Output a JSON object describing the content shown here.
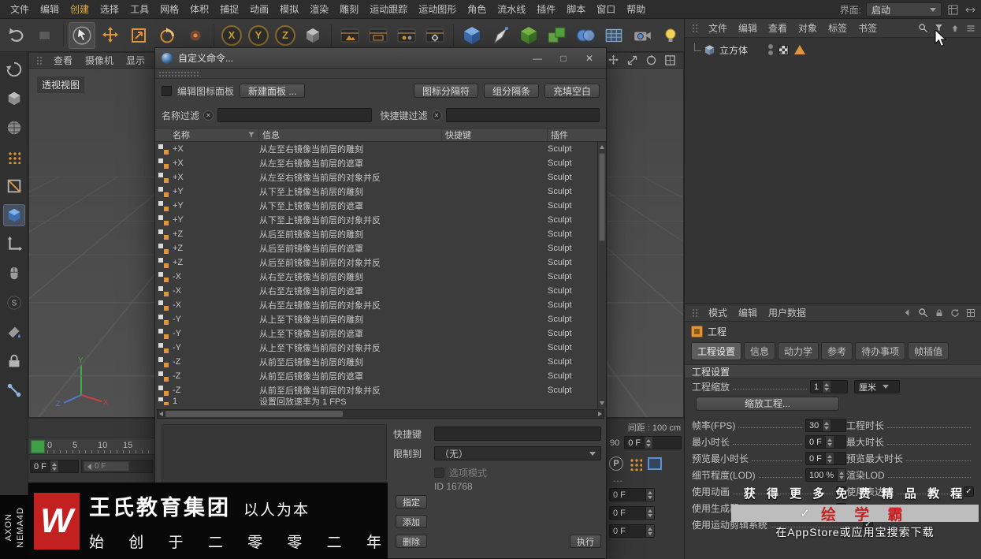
{
  "menubar": {
    "items": [
      "文件",
      "编辑",
      "创建",
      "选择",
      "工具",
      "网格",
      "体积",
      "捕捉",
      "动画",
      "模拟",
      "渲染",
      "雕刻",
      "运动跟踪",
      "运动图形",
      "角色",
      "流水线",
      "插件",
      "脚本",
      "窗口",
      "帮助"
    ],
    "highlight": "创建",
    "interface_label": "界面:",
    "interface_value": "启动"
  },
  "toolbar": {
    "axis_x": "X",
    "axis_y": "Y",
    "axis_z": "Z"
  },
  "viewport": {
    "menu": [
      "查看",
      "摄像机",
      "显示"
    ],
    "label": "透视视图",
    "axis_y": "Y",
    "axis_x": "X",
    "axis_z": "Z"
  },
  "timeline": {
    "ticks": [
      "0",
      "5",
      "10",
      "15"
    ],
    "frame_value": "0 F",
    "slider_value": "0 F",
    "range_end": "90",
    "range_value": "0 F",
    "spacing_text": "间距 : 100 cm",
    "record_letter": "P",
    "ellipsis": "⋯",
    "side_values": [
      "0 F",
      "0 F",
      "0 F"
    ]
  },
  "dialog": {
    "title": "自定义命令...",
    "minimize": "—",
    "maximize": "□",
    "close": "✕",
    "edit_palette_label": "编辑图标面板",
    "new_palette_button": "新建面板 ...",
    "icon_separator_button": "图标分隔符",
    "group_separator_button": "组分隔条",
    "fill_blank_button": "充填空白",
    "name_filter_label": "名称过滤",
    "shortcut_filter_label": "快捷键过滤",
    "clear_glyph": "✕",
    "columns": {
      "name": "名称",
      "info": "信息",
      "shortcut": "快捷键",
      "plugin": "插件"
    },
    "rows": [
      {
        "name": "+X",
        "info": "从左至右镜像当前层的雕刻",
        "shortcut": "",
        "plugin": "Sculpt"
      },
      {
        "name": "+X",
        "info": "从左至右镜像当前层的遮罩",
        "shortcut": "",
        "plugin": "Sculpt"
      },
      {
        "name": "+X",
        "info": "从左至右镜像当前层的对象并反",
        "shortcut": "",
        "plugin": "Sculpt"
      },
      {
        "name": "+Y",
        "info": "从下至上镜像当前层的雕刻",
        "shortcut": "",
        "plugin": "Sculpt"
      },
      {
        "name": "+Y",
        "info": "从下至上镜像当前层的遮罩",
        "shortcut": "",
        "plugin": "Sculpt"
      },
      {
        "name": "+Y",
        "info": "从下至上镜像当前层的对象并反",
        "shortcut": "",
        "plugin": "Sculpt"
      },
      {
        "name": "+Z",
        "info": "从后至前镜像当前层的雕刻",
        "shortcut": "",
        "plugin": "Sculpt"
      },
      {
        "name": "+Z",
        "info": "从后至前镜像当前层的遮罩",
        "shortcut": "",
        "plugin": "Sculpt"
      },
      {
        "name": "+Z",
        "info": "从后至前镜像当前层的对象并反",
        "shortcut": "",
        "plugin": "Sculpt"
      },
      {
        "name": "-X",
        "info": "从右至左镜像当前层的雕刻",
        "shortcut": "",
        "plugin": "Sculpt"
      },
      {
        "name": "-X",
        "info": "从右至左镜像当前层的遮罩",
        "shortcut": "",
        "plugin": "Sculpt"
      },
      {
        "name": "-X",
        "info": "从右至左镜像当前层的对象并反",
        "shortcut": "",
        "plugin": "Sculpt"
      },
      {
        "name": "-Y",
        "info": "从上至下镜像当前层的雕刻",
        "shortcut": "",
        "plugin": "Sculpt"
      },
      {
        "name": "-Y",
        "info": "从上至下镜像当前层的遮罩",
        "shortcut": "",
        "plugin": "Sculpt"
      },
      {
        "name": "-Y",
        "info": "从上至下镜像当前层的对象并反",
        "shortcut": "",
        "plugin": "Sculpt"
      },
      {
        "name": "-Z",
        "info": "从前至后镜像当前层的雕刻",
        "shortcut": "",
        "plugin": "Sculpt"
      },
      {
        "name": "-Z",
        "info": "从前至后镜像当前层的遮罩",
        "shortcut": "",
        "plugin": "Sculpt"
      },
      {
        "name": "-Z",
        "info": "从前至后镜像当前层的对象并反",
        "shortcut": "",
        "plugin": "Sculpt"
      }
    ],
    "partial_row": {
      "name": "1",
      "info": "设置回放速率为 1 FPS",
      "plugin": ""
    },
    "shortcut_label": "快捷键",
    "restrict_label": "限制到",
    "restrict_value": "（无）",
    "option_mode_label": "选项模式",
    "id_text": "ID 16768",
    "assign_button": "指定",
    "add_button": "添加",
    "delete_button": "删除",
    "execute_button": "执行"
  },
  "object_manager": {
    "menu": [
      "文件",
      "编辑",
      "查看",
      "对象",
      "标签",
      "书签"
    ],
    "object_name": "立方体"
  },
  "attributes": {
    "menu": [
      "模式",
      "编辑",
      "用户数据"
    ],
    "title": "工程",
    "tabs": [
      "工程设置",
      "信息",
      "动力学",
      "参考",
      "待办事项",
      "帧插值"
    ],
    "active_tab": "工程设置",
    "section_title": "工程设置",
    "scale_label": "工程缩放",
    "scale_value": "1",
    "scale_unit": "厘米",
    "scale_button": "缩放工程...",
    "fps_label": "帧率(FPS)",
    "fps_value": "30",
    "duration_label": "工程时长",
    "min_label": "最小时长",
    "min_value": "0 F",
    "max_label": "最大时长",
    "pmin_label": "预览最小时长",
    "pmin_value": "0 F",
    "pmax_label": "预览最大时长",
    "lod_label": "细节程度(LOD)",
    "lod_value": "100 %",
    "render_lod_label": "渲染LOD",
    "use_anim_label": "使用动画",
    "use_expr_label": "使用表达式",
    "use_gen_label": "使用生成器",
    "use_motion_label": "使用运动剪辑系统",
    "check_glyph": "✓"
  },
  "watermark": {
    "logo_letter": "W",
    "brand": "王氏教育集团",
    "slogan": "以人为本",
    "since": "始 创 于 二 零 零 二 年",
    "vertical_top": "AXON",
    "vertical_bottom": "NEMA4D",
    "promo_line1": "获 得 更 多 免 费 精 品 教 程",
    "promo_check": "✓",
    "promo_line2": "绘 学 霸",
    "promo_line3": "在AppStore或应用宝搜索下载"
  }
}
